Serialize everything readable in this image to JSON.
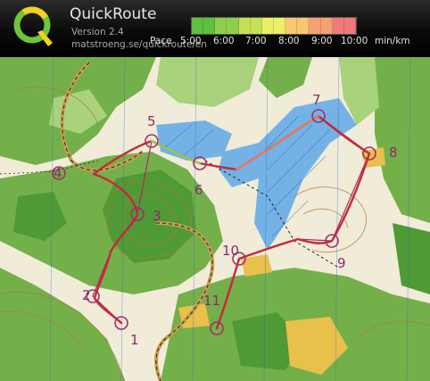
{
  "app": {
    "title": "QuickRoute",
    "version": "Version 2.4",
    "url": "matstroeng.se/quickroute/en"
  },
  "legend": {
    "label": "Pace",
    "ticks": [
      "5:00",
      "6:00",
      "7:00",
      "8:00",
      "9:00",
      "10:00"
    ],
    "unit": "min/km",
    "gradient_colors": [
      "#5fbf3f",
      "#8fcf4f",
      "#c6e05a",
      "#eeee66",
      "#f8c870",
      "#f5a070",
      "#f07a7a"
    ]
  },
  "controls": [
    "1",
    "2",
    "3",
    "4",
    "5",
    "6",
    "7",
    "8",
    "9",
    "10",
    "11"
  ],
  "colors": {
    "route": "#c8283c",
    "control_circle": "#a0306a",
    "forest": "#6fae45",
    "open_land": "#f2efdf",
    "marsh": "#3f8fd6"
  }
}
